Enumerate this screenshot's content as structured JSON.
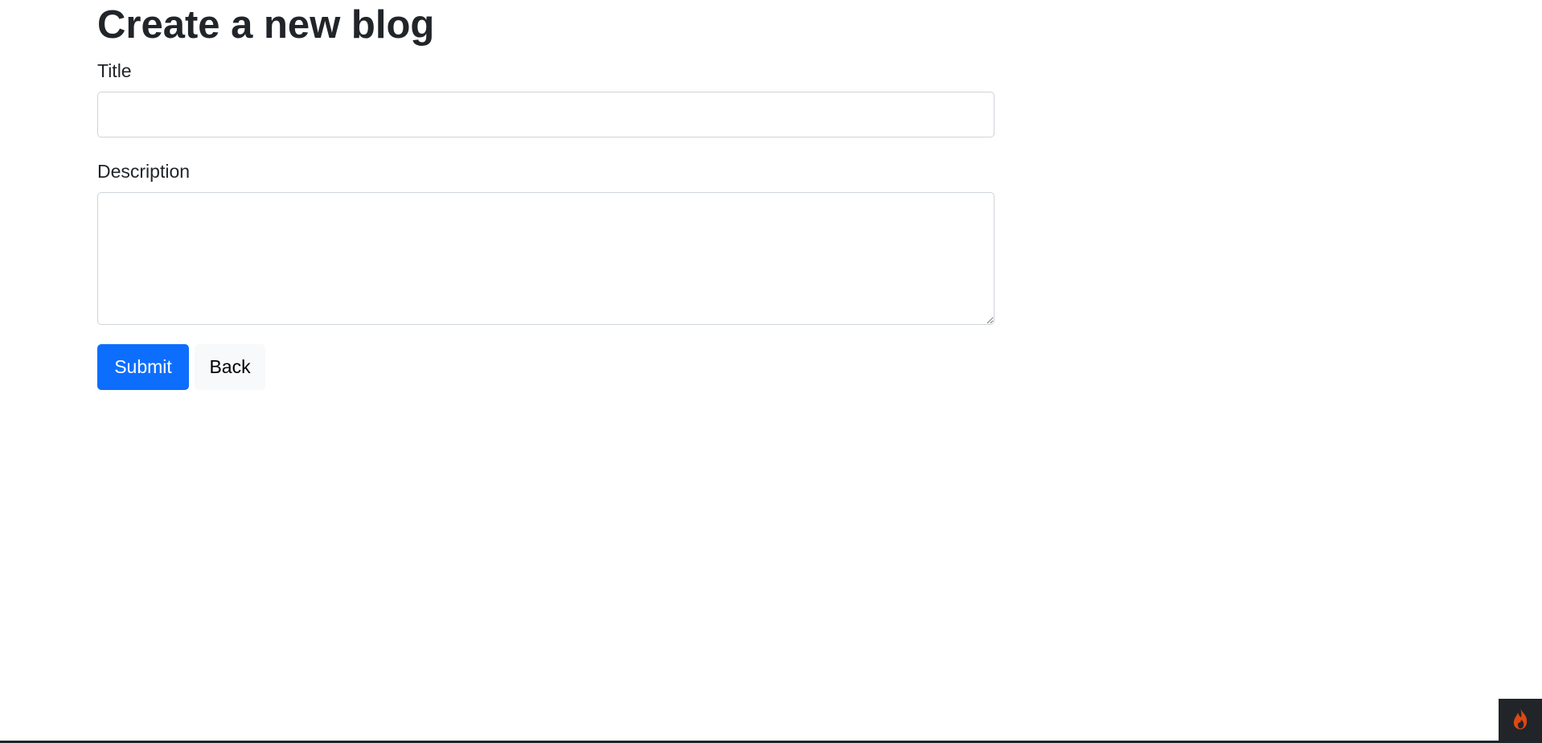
{
  "page": {
    "heading": "Create a new blog"
  },
  "form": {
    "title_label": "Title",
    "title_value": "",
    "description_label": "Description",
    "description_value": "",
    "submit_label": "Submit",
    "back_label": "Back"
  },
  "colors": {
    "primary": "#0d6efd",
    "light": "#f8f9fa",
    "text": "#212529",
    "toolbar_icon": "#dd4814"
  },
  "icons": {
    "debug_toolbar": "flame-icon"
  }
}
